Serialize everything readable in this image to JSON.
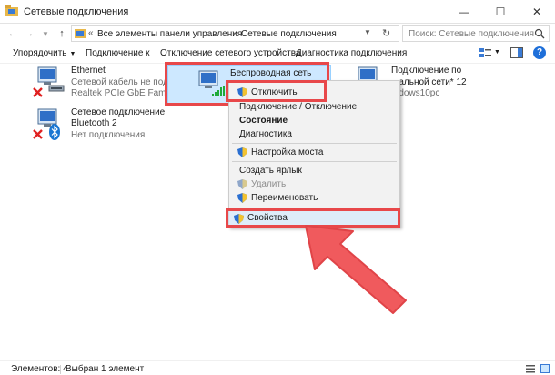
{
  "window": {
    "title": "Сетевые подключения"
  },
  "address": {
    "separator": "«",
    "crumbs": [
      "Все элементы панели управления",
      "Сетевые подключения"
    ],
    "crumb_sep": "›"
  },
  "search": {
    "placeholder": "Поиск: Сетевые подключения"
  },
  "toolbar": {
    "organize": "Упорядочить",
    "connect_to": "Подключение к",
    "disable": "Отключение сетевого устройства",
    "diagnose": "Диагностика подключения"
  },
  "items": {
    "ethernet": {
      "name": "Ethernet",
      "status": "Сетевой кабель не подкл...",
      "adapter": "Realtek PCIe GbE Family C..."
    },
    "bluetooth": {
      "name": "Сетевое подключение",
      "name2": "Bluetooth 2",
      "status": "Нет подключения"
    },
    "wifi": {
      "name": "Беспроводная сеть"
    },
    "local": {
      "name": "Подключение по",
      "name2": "...альной сети* 12",
      "sub": "...dows10pc"
    }
  },
  "context_menu": {
    "disconnect": "Отключить",
    "connect_disconnect": "Подключение / Отключение",
    "status": "Состояние",
    "diagnostics": "Диагностика",
    "bridge": "Настройка моста",
    "shortcut": "Создать ярлык",
    "delete": "Удалить",
    "rename": "Переименовать",
    "properties": "Свойства"
  },
  "statusbar": {
    "count": "Элементов: 4",
    "selected": "Выбран 1 элемент"
  },
  "colors": {
    "highlight": "#e8484a",
    "selection": "#cde8ff",
    "accent": "#1e6fd9"
  },
  "icons": [
    "network-folder-icon",
    "back-arrow-icon",
    "forward-arrow-icon",
    "up-arrow-icon",
    "refresh-icon",
    "search-icon",
    "network-adapter-icon",
    "error-x-icon",
    "bluetooth-icon",
    "wifi-signal-icon",
    "shield-icon",
    "pointer-arrow-icon"
  ]
}
